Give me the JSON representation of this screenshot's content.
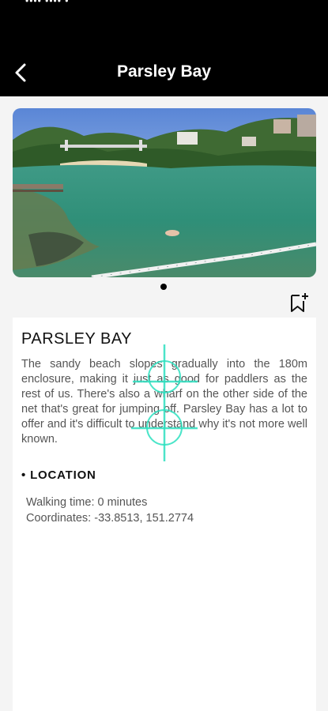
{
  "status_bar": {
    "text": "•••• •••• •"
  },
  "header": {
    "title": "Parsley Bay",
    "back_icon": "chevron-left-icon"
  },
  "hero": {
    "image_description_icon": "bay-photo",
    "pager": {
      "count": 1,
      "active": 0
    }
  },
  "bookmark": {
    "icon": "bookmark-add-icon"
  },
  "place": {
    "heading": "PARSLEY BAY",
    "description": "The sandy beach slopes gradually into the 180m enclosure, making it just as good for paddlers as the rest of us. There's also a wharf on the other side of the net that's great for jumping off. Parsley Bay has a lot to offer and it's difficult to understand why it's not more well known."
  },
  "location": {
    "bullet": "•",
    "heading": "LOCATION",
    "walking_time": "Walking time: 0 minutes",
    "coordinates": "Coordinates: -33.8513, 151.2774"
  },
  "colors": {
    "header_bg": "#000000",
    "page_bg": "#f4f4f4",
    "card_bg": "#ffffff",
    "crosshair": "#2de0c0"
  }
}
